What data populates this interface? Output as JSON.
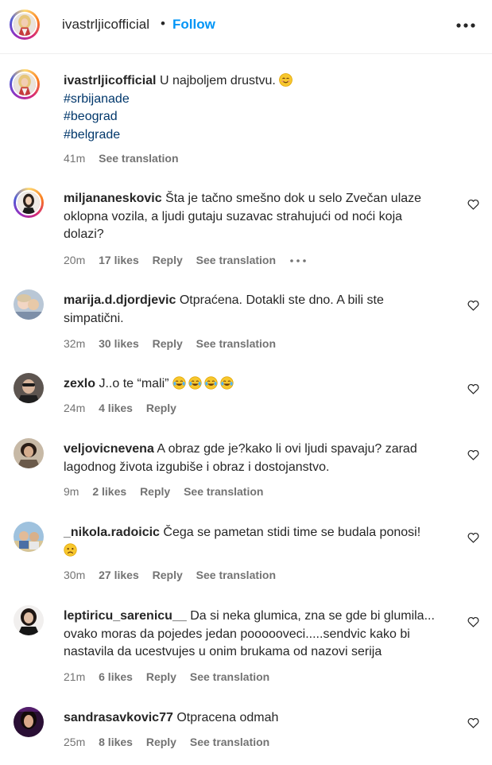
{
  "header": {
    "username": "ivastrljicofficial",
    "separator": "•",
    "follow_label": "Follow",
    "more_icon": "more-horizontal-icon"
  },
  "caption": {
    "username": "ivastrljicofficial",
    "text": "U najboljem drustvu.",
    "emoji": "smiling-face-emoji",
    "hashtags": [
      "#srbijanade",
      "#beograd",
      "#belgrade"
    ],
    "time": "41m",
    "translate": "See translation"
  },
  "comments": [
    {
      "username": "miljananeskovic",
      "text": "Šta je tačno smešno dok u selo Zvečan ulaze oklopna vozila, a ljudi gutaju suzavac strahujući od noći koja dolazi?",
      "time": "20m",
      "likes": "17 likes",
      "reply": "Reply",
      "translate": "See translation"
    },
    {
      "username": "marija.d.djordjevic",
      "text": "Otpraćena. Dotakli ste dno. A bili ste simpatični.",
      "time": "32m",
      "likes": "30 likes",
      "reply": "Reply",
      "translate": "See translation"
    },
    {
      "username": "zexlo",
      "text": "J..o te “mali”",
      "time": "24m",
      "likes": "4 likes",
      "reply": "Reply"
    },
    {
      "username": "veljovicnevena",
      "text": "A obraz gde je?kako li ovi ljudi spavaju? zarad lagodnog života izgubiše i obraz i dostojanstvo.",
      "time": "9m",
      "likes": "2 likes",
      "reply": "Reply",
      "translate": "See translation"
    },
    {
      "username": "_nikola.radoicic",
      "text": "Čega se pametan stidi time se budala ponosi!",
      "time": "30m",
      "likes": "27 likes",
      "reply": "Reply",
      "translate": "See translation"
    },
    {
      "username": "leptiricu_sarenicu__",
      "text": "Da si neka glumica, zna se gde bi glumila... ovako moras da pojedes jedan poooooveci.....sendvic kako bi nastavila da ucestvujes u onim brukama od nazovi serija",
      "time": "21m",
      "likes": "6 likes",
      "reply": "Reply",
      "translate": "See translation"
    },
    {
      "username": "sandrasavkovic77",
      "text": "Otpracena odmah",
      "time": "25m",
      "likes": "8 likes",
      "reply": "Reply",
      "translate": "See translation"
    }
  ]
}
